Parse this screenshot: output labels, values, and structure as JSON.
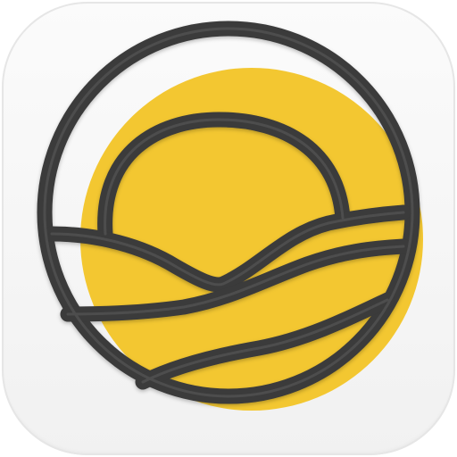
{
  "app_icon": {
    "icon": "sunrise-over-waves-logo-icon",
    "colors": {
      "tile": "#f4f4f4",
      "sun_disc": "#f3c731",
      "outline": "#3a3a3a",
      "outline_highlight": "#5a5a5a"
    }
  }
}
